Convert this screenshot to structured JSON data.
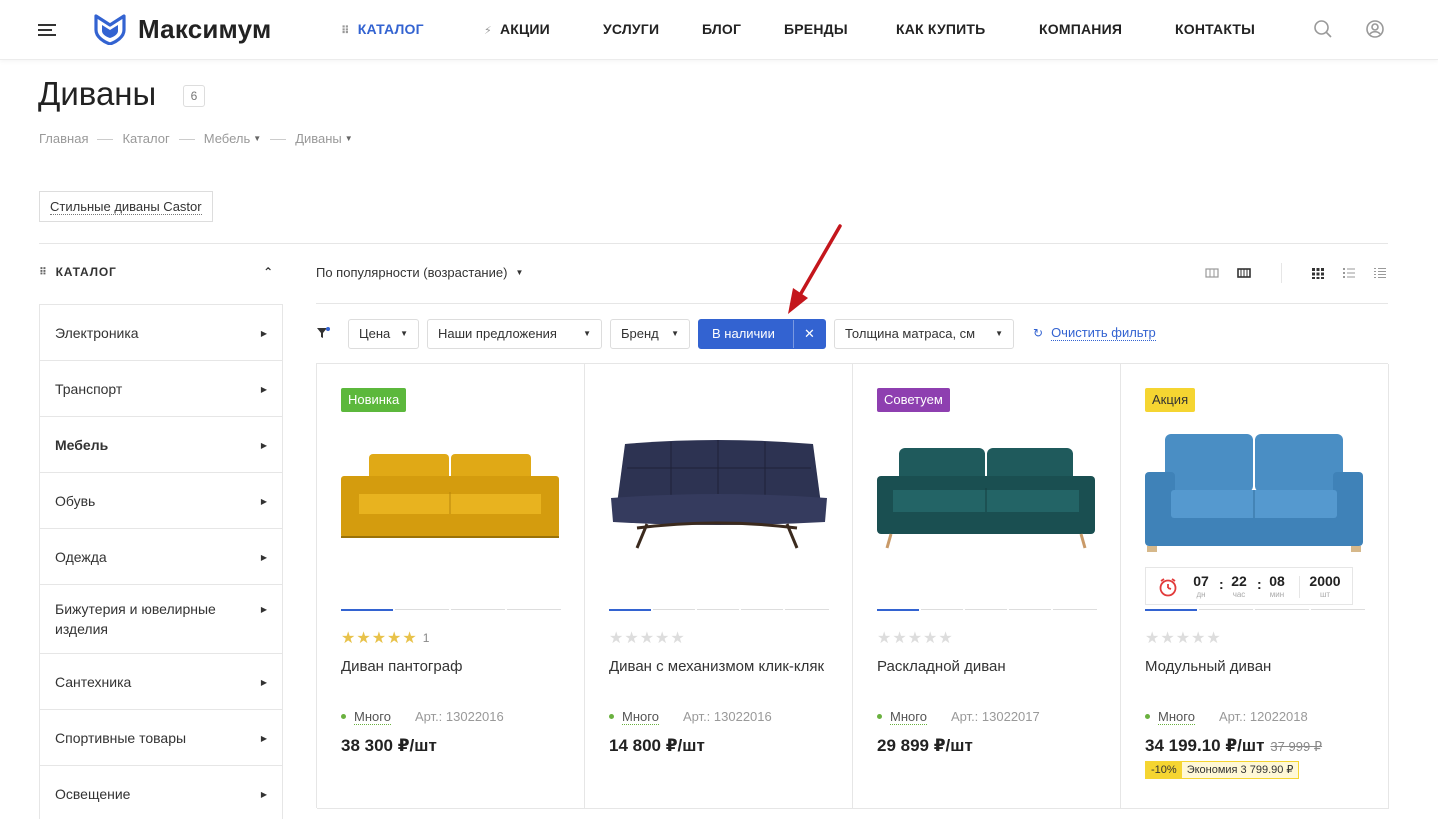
{
  "header": {
    "logo": "Максимум",
    "nav": [
      {
        "label": "КАТАЛОГ",
        "icon": "grid-icon",
        "active": true
      },
      {
        "label": "АКЦИИ",
        "icon": "bolt-icon"
      },
      {
        "label": "УСЛУГИ"
      },
      {
        "label": "БЛОГ"
      },
      {
        "label": "БРЕНДЫ"
      },
      {
        "label": "КАК КУПИТЬ"
      },
      {
        "label": "КОМПАНИЯ"
      },
      {
        "label": "КОНТАКТЫ"
      }
    ],
    "accent_color": "#3363d1"
  },
  "page": {
    "title": "Диваны",
    "count": "6",
    "breadcrumb": [
      "Главная",
      "Каталог",
      "Мебель",
      "Диваны"
    ],
    "tag": "Стильные диваны Castor"
  },
  "sidebar": {
    "title": "КАТАЛОГ",
    "items": [
      {
        "label": "Электроника"
      },
      {
        "label": "Транспорт"
      },
      {
        "label": "Мебель",
        "active": true
      },
      {
        "label": "Обувь"
      },
      {
        "label": "Одежда"
      },
      {
        "label": "Бижутерия и ювелирные изделия"
      },
      {
        "label": "Сантехника"
      },
      {
        "label": "Спортивные товары"
      },
      {
        "label": "Освещение"
      }
    ]
  },
  "sort": {
    "label": "По популярности (возрастание)"
  },
  "filters": {
    "price": "Цена",
    "offers": "Наши предложения",
    "brand": "Бренд",
    "in_stock": "В наличии",
    "thickness": "Толщина матраса, см",
    "clear": "Очистить фильтр"
  },
  "products": [
    {
      "badge": "Новинка",
      "badge_color": "#5cb83c",
      "rating": 5,
      "reviews": "1",
      "name": "Диван пантограф",
      "stock": "Много",
      "article": "Арт.: 13022016",
      "price": "38 300 ₽/шт",
      "sofa_color": "#e0a916"
    },
    {
      "badge": "",
      "rating": 0,
      "name": "Диван с механизмом клик-кляк",
      "stock": "Много",
      "article": "Арт.: 13022016",
      "price": "14 800 ₽/шт",
      "sofa_color": "#2d3352"
    },
    {
      "badge": "Советуем",
      "badge_color": "#8e3fb0",
      "rating": 0,
      "name": "Раскладной диван",
      "stock": "Много",
      "article": "Арт.: 13022017",
      "price": "29 899 ₽/шт",
      "sofa_color": "#1f5a5c"
    },
    {
      "badge": "Акция",
      "badge_color": "#f5d531",
      "rating": 0,
      "name": "Модульный диван",
      "stock": "Много",
      "article": "Арт.: 12022018",
      "price": "34 199.10 ₽/шт",
      "old_price": "37 999 ₽",
      "discount": "-10%",
      "economy": "Экономия 3 799.90 ₽",
      "sofa_color": "#4a8ec4",
      "timer": {
        "days": "07",
        "days_label": "дн",
        "hours": "22",
        "hours_label": "час",
        "minutes": "08",
        "minutes_label": "мин",
        "qty": "2000",
        "qty_label": "шт"
      }
    }
  ]
}
